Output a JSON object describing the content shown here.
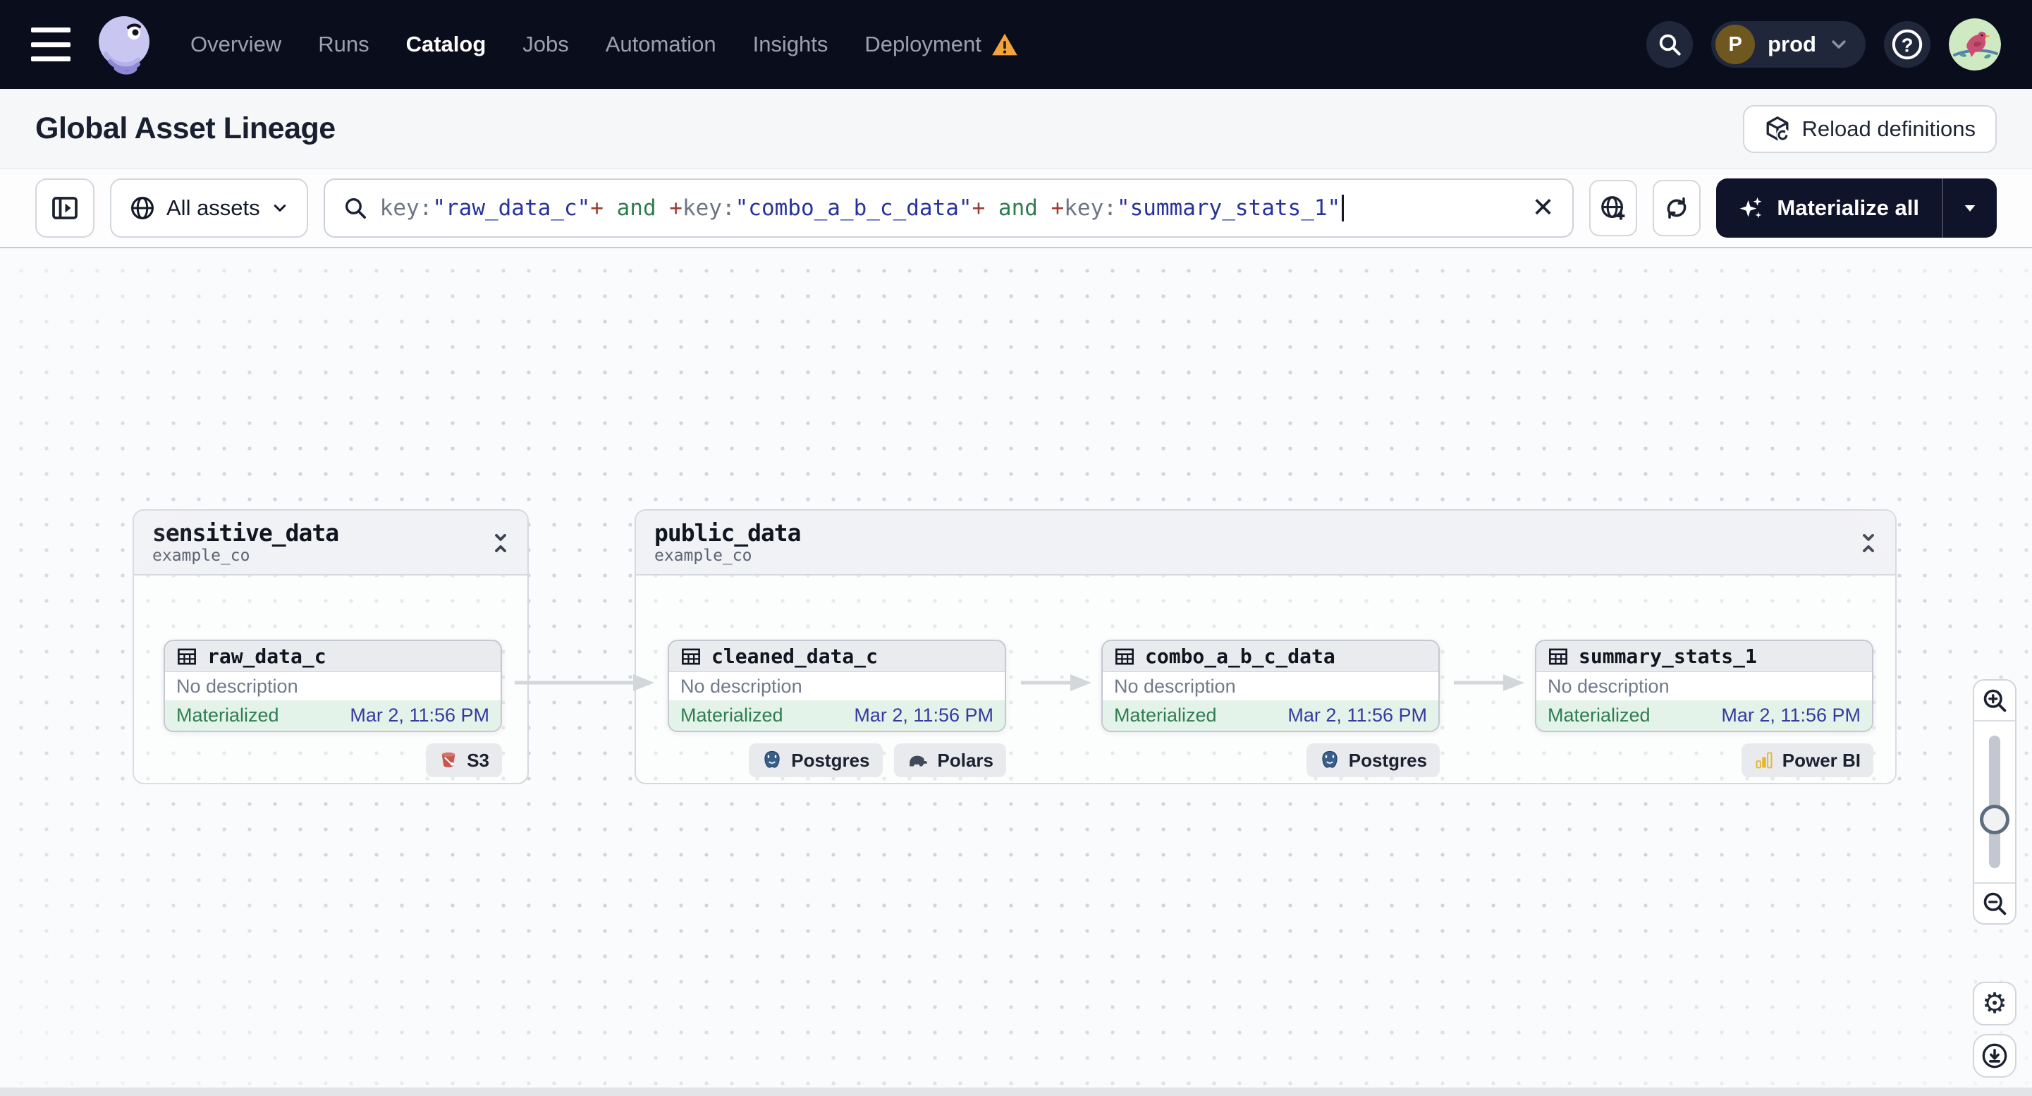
{
  "nav": {
    "menu_items": [
      {
        "label": "Overview"
      },
      {
        "label": "Runs"
      },
      {
        "label": "Catalog"
      },
      {
        "label": "Jobs"
      },
      {
        "label": "Automation"
      },
      {
        "label": "Insights"
      },
      {
        "label": "Deployment"
      }
    ],
    "active_item": "Catalog",
    "deployment_has_warning": true,
    "env_switcher": {
      "initial": "P",
      "name": "prod"
    }
  },
  "header": {
    "title": "Global Asset Lineage",
    "reload_button_label": "Reload definitions"
  },
  "toolbar": {
    "scope_button_label": "All assets",
    "query": {
      "segments": {
        "s0": "key:",
        "s1": "\"raw_data_c\"",
        "s2": "+",
        "s3": " and ",
        "s4": "+",
        "s5": "key:",
        "s6": "\"combo_a_b_c_data\"",
        "s7": "+",
        "s8": " and ",
        "s9": "+",
        "s10": "key:",
        "s11": "\"summary_stats_1\""
      },
      "full_text": "key:\"raw_data_c\"+ and +key:\"combo_a_b_c_data\"+ and +key:\"summary_stats_1\""
    },
    "clear_label": "✕",
    "materialize_button_label": "Materialize all"
  },
  "graph": {
    "groups": [
      {
        "name": "sensitive_data",
        "location": "example_co"
      },
      {
        "name": "public_data",
        "location": "example_co"
      }
    ],
    "assets": [
      {
        "name": "raw_data_c",
        "description": "No description",
        "status": "Materialized",
        "materialized_at": "Mar 2, 11:56 PM",
        "tags": [
          {
            "label": "S3",
            "icon": "s3-bucket-icon"
          }
        ]
      },
      {
        "name": "cleaned_data_c",
        "description": "No description",
        "status": "Materialized",
        "materialized_at": "Mar 2, 11:56 PM",
        "tags": [
          {
            "label": "Postgres",
            "icon": "postgres-icon"
          },
          {
            "label": "Polars",
            "icon": "polars-icon"
          }
        ]
      },
      {
        "name": "combo_a_b_c_data",
        "description": "No description",
        "status": "Materialized",
        "materialized_at": "Mar 2, 11:56 PM",
        "tags": [
          {
            "label": "Postgres",
            "icon": "postgres-icon"
          }
        ]
      },
      {
        "name": "summary_stats_1",
        "description": "No description",
        "status": "Materialized",
        "materialized_at": "Mar 2, 11:56 PM",
        "tags": [
          {
            "label": "Power BI",
            "icon": "powerbi-icon"
          }
        ]
      }
    ]
  },
  "colors": {
    "nav_background": "#0a0d1c",
    "warning_orange": "#f2a33c",
    "status_green": "#2f7d50",
    "status_green_bg": "#e4f3e9",
    "timestamp_blue": "#333b9e",
    "query_string": "#27339b",
    "query_operator": "#9e3b31",
    "query_keyword": "#2f7d4f",
    "materialize_button_bg": "#10142a"
  }
}
